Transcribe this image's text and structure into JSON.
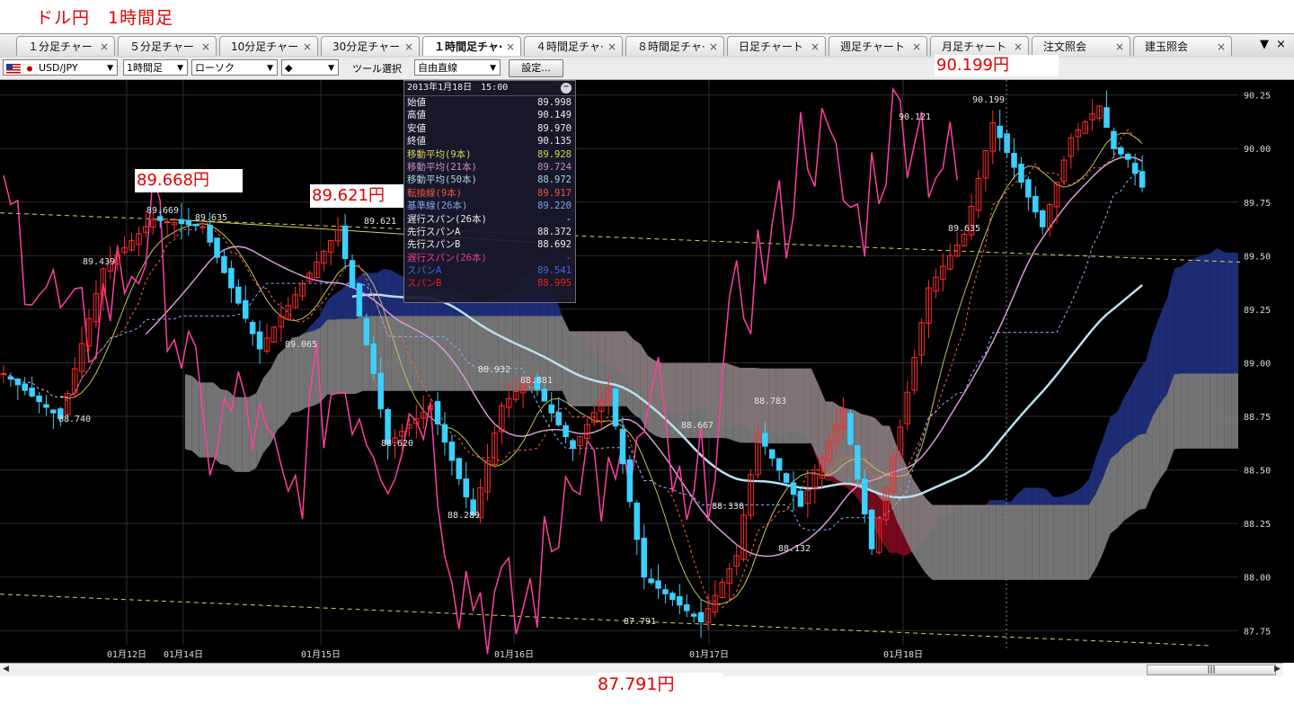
{
  "page_title": "ドル円　1時間足",
  "tabs": [
    {
      "label": "１分足チャー",
      "close": "×"
    },
    {
      "label": "５分足チャー",
      "close": "×"
    },
    {
      "label": "10分足チャー",
      "close": "×"
    },
    {
      "label": "30分足チャー",
      "close": "×"
    },
    {
      "label": "１時間足チャ·",
      "close": "×"
    },
    {
      "label": "４時間足チャ·",
      "close": "×"
    },
    {
      "label": "８時間足チャ·",
      "close": "×"
    },
    {
      "label": "日足チャート",
      "close": "×"
    },
    {
      "label": "週足チャート",
      "close": "×"
    },
    {
      "label": "月足チャート",
      "close": "×"
    },
    {
      "label": "注文照会",
      "close": "×"
    },
    {
      "label": "建玉照会",
      "close": "×"
    }
  ],
  "tab_controls": {
    "menu": "▼",
    "close": "×"
  },
  "toolbar": {
    "symbol": "USD/JPY",
    "timeframe": "1時間足",
    "chart_style": "ローソク",
    "marker": "◆",
    "tool_label": "ツール選択",
    "tool_value": "自由直線",
    "settings_button": "設定..."
  },
  "annotations": {
    "left_high": "89.668円",
    "mid_high": "89.621円",
    "right_high": "90.199円",
    "bottom_low": "87.791円"
  },
  "info_panel": {
    "header": "2013年1月18日　15:00",
    "rows": [
      {
        "label": "始値",
        "value": "89.998",
        "color": "#ffffff"
      },
      {
        "label": "高値",
        "value": "90.149",
        "color": "#ffffff"
      },
      {
        "label": "安値",
        "value": "89.970",
        "color": "#ffffff"
      },
      {
        "label": "終値",
        "value": "90.135",
        "color": "#ffffff"
      },
      {
        "label": "移動平均(9本)",
        "value": "89.928",
        "color": "#e8e060"
      },
      {
        "label": "移動平均(21本)",
        "value": "89.724",
        "color": "#d89ad8"
      },
      {
        "label": "移動平均(50本)",
        "value": "88.972",
        "color": "#b8e0f0"
      },
      {
        "label": "転換線(9本)",
        "value": "89.917",
        "color": "#ff6040"
      },
      {
        "label": "基準線(26本)",
        "value": "89.220",
        "color": "#8ab4ff"
      },
      {
        "label": "遅行スパン(26本)",
        "value": "-",
        "color": "#ffffff"
      },
      {
        "label": "先行スパンA",
        "value": "88.372",
        "color": "#ffffff"
      },
      {
        "label": "先行スパンB",
        "value": "88.692",
        "color": "#ffffff"
      },
      {
        "label": "遅行スパン(26本)",
        "value": "-",
        "color": "#ff40a0"
      },
      {
        "label": "スパンA",
        "value": "89.541",
        "color": "#4a6cff"
      },
      {
        "label": "スパンB",
        "value": "88.995",
        "color": "#ff2020"
      }
    ]
  },
  "chart_data": {
    "type": "candlestick",
    "symbol": "USD/JPY",
    "ylim": [
      87.6,
      90.32
    ],
    "y_ticks": [
      "90.25",
      "90.00",
      "89.75",
      "89.50",
      "89.25",
      "89.00",
      "88.75",
      "88.50",
      "88.25",
      "88.00",
      "87.75"
    ],
    "x_ticks": [
      "01月12日",
      "01月14日",
      "01月15日",
      "01月16日",
      "01月17日",
      "01月18日"
    ],
    "price_labels": [
      "89.439",
      "88.740",
      "89.669",
      "89.635",
      "89.065",
      "89.621",
      "88.620",
      "88.289",
      "88.932",
      "88.881",
      "87.791",
      "88.667",
      "88.330",
      "88.783",
      "88.132",
      "90.121",
      "90.199",
      "89.635"
    ],
    "key_points": [
      {
        "x": 0,
        "y": 88.95
      },
      {
        "x": 8,
        "y": 88.74
      },
      {
        "x": 14,
        "y": 89.439
      },
      {
        "x": 21,
        "y": 89.669
      },
      {
        "x": 28,
        "y": 89.635
      },
      {
        "x": 36,
        "y": 89.065
      },
      {
        "x": 47,
        "y": 89.621
      },
      {
        "x": 52,
        "y": 88.95
      },
      {
        "x": 54,
        "y": 88.62
      },
      {
        "x": 60,
        "y": 88.8
      },
      {
        "x": 66,
        "y": 88.289
      },
      {
        "x": 70,
        "y": 88.8
      },
      {
        "x": 74,
        "y": 88.932
      },
      {
        "x": 80,
        "y": 88.6
      },
      {
        "x": 85,
        "y": 88.881
      },
      {
        "x": 90,
        "y": 88.0
      },
      {
        "x": 98,
        "y": 87.791
      },
      {
        "x": 103,
        "y": 88.1
      },
      {
        "x": 106,
        "y": 88.667
      },
      {
        "x": 112,
        "y": 88.33
      },
      {
        "x": 118,
        "y": 88.783
      },
      {
        "x": 122,
        "y": 88.132
      },
      {
        "x": 126,
        "y": 88.7
      },
      {
        "x": 130,
        "y": 89.35
      },
      {
        "x": 135,
        "y": 89.6
      },
      {
        "x": 139,
        "y": 90.121
      },
      {
        "x": 146,
        "y": 89.635
      },
      {
        "x": 150,
        "y": 90.05
      },
      {
        "x": 154,
        "y": 90.199
      },
      {
        "x": 156,
        "y": 90.0
      },
      {
        "x": 158,
        "y": 89.95
      },
      {
        "x": 160,
        "y": 89.82
      }
    ],
    "grid": true
  }
}
